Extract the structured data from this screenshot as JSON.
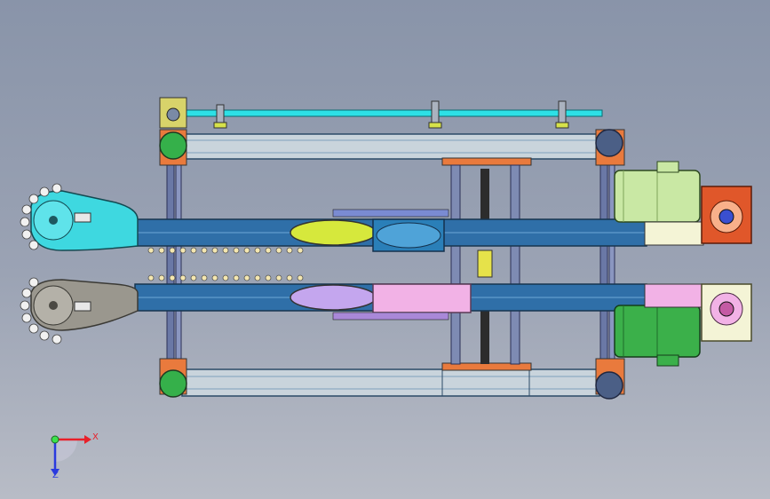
{
  "viewport": {
    "background_top": "#8994a9",
    "background_bottom": "#b8bcc6"
  },
  "triad": {
    "x_label": "X",
    "y_label": "Z",
    "x_color": "#e8202a",
    "y_color": "#2a3adf",
    "origin_color": "#3ce24c"
  },
  "colors": {
    "rail": "#2f6fa8",
    "upper_sprocket_plate": "#3ed8e0",
    "lower_sprocket_plate": "#9a978e",
    "motor": "#3bb04a",
    "motor_light": "#c9e8a4",
    "gearbox_orange": "#e0572a",
    "gearbox_pink": "#f2b2e6",
    "frame_beam": "#c9d4dc",
    "bracket_orange": "#e97a3d",
    "wheel_green": "#35b04a",
    "cyan_rod": "#2de0e6"
  }
}
